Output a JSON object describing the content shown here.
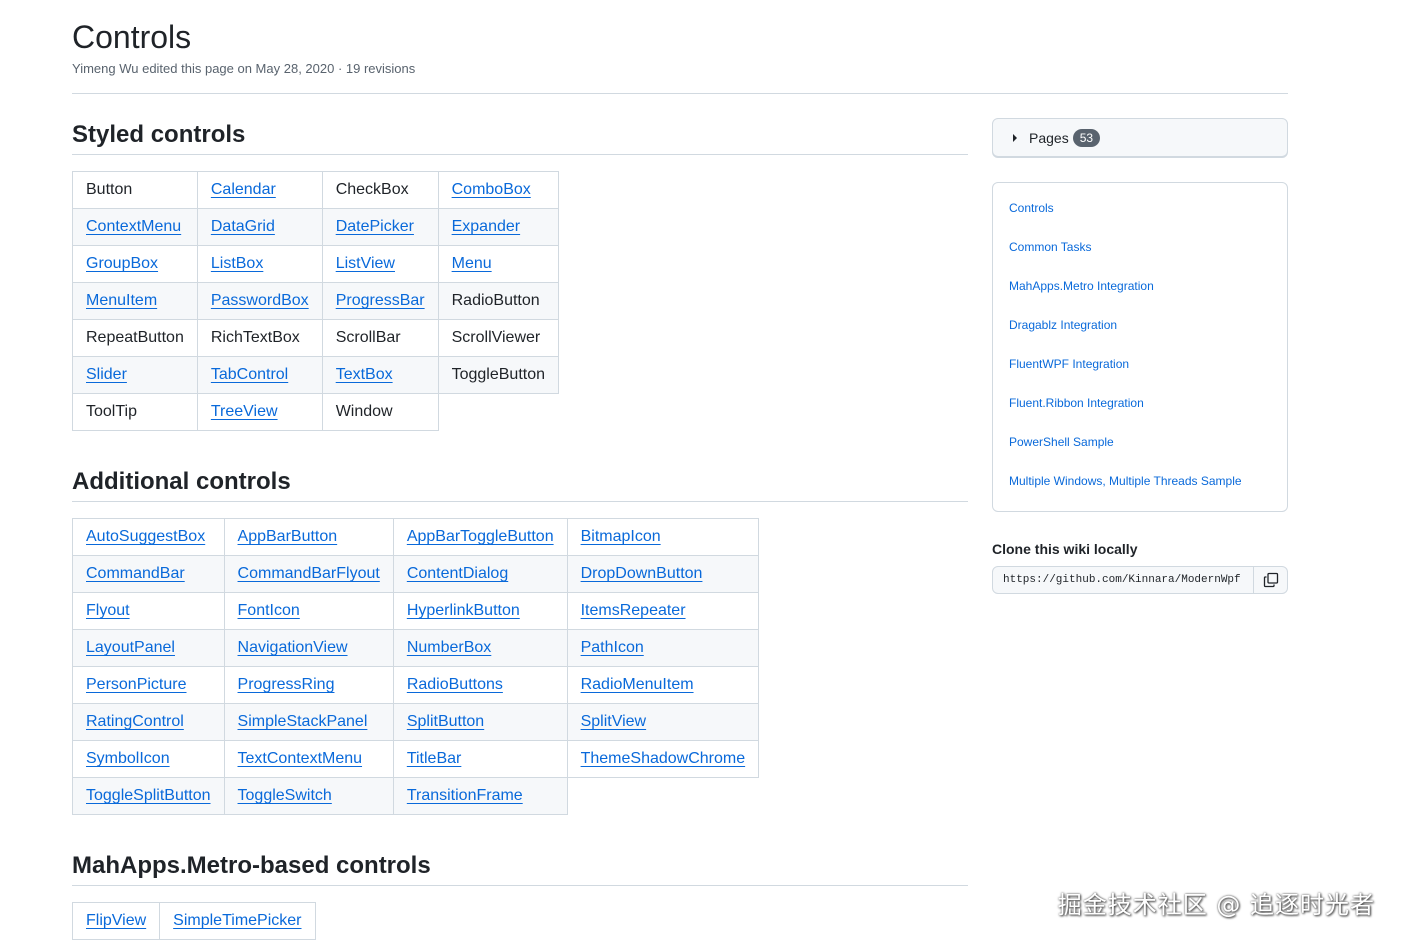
{
  "header": {
    "title": "Controls",
    "meta": "Yimeng Wu edited this page on May 28, 2020 · 19 revisions"
  },
  "sections": [
    {
      "title": "Styled controls",
      "rows": [
        [
          {
            "text": "Button",
            "link": false
          },
          {
            "text": "Calendar",
            "link": true
          },
          {
            "text": "CheckBox",
            "link": false
          },
          {
            "text": "ComboBox",
            "link": true
          }
        ],
        [
          {
            "text": "ContextMenu",
            "link": true
          },
          {
            "text": "DataGrid",
            "link": true
          },
          {
            "text": "DatePicker",
            "link": true
          },
          {
            "text": "Expander",
            "link": true
          }
        ],
        [
          {
            "text": "GroupBox",
            "link": true
          },
          {
            "text": "ListBox",
            "link": true
          },
          {
            "text": "ListView",
            "link": true
          },
          {
            "text": "Menu",
            "link": true
          }
        ],
        [
          {
            "text": "MenuItem",
            "link": true
          },
          {
            "text": "PasswordBox",
            "link": true
          },
          {
            "text": "ProgressBar",
            "link": true
          },
          {
            "text": "RadioButton",
            "link": false
          }
        ],
        [
          {
            "text": "RepeatButton",
            "link": false
          },
          {
            "text": "RichTextBox",
            "link": false
          },
          {
            "text": "ScrollBar",
            "link": false
          },
          {
            "text": "ScrollViewer",
            "link": false
          }
        ],
        [
          {
            "text": "Slider",
            "link": true
          },
          {
            "text": "TabControl",
            "link": true
          },
          {
            "text": "TextBox",
            "link": true
          },
          {
            "text": "ToggleButton",
            "link": false
          }
        ],
        [
          {
            "text": "ToolTip",
            "link": false
          },
          {
            "text": "TreeView",
            "link": true
          },
          {
            "text": "Window",
            "link": false
          }
        ]
      ]
    },
    {
      "title": "Additional controls",
      "rows": [
        [
          {
            "text": "AutoSuggestBox",
            "link": true
          },
          {
            "text": "AppBarButton",
            "link": true
          },
          {
            "text": "AppBarToggleButton",
            "link": true
          },
          {
            "text": "BitmapIcon",
            "link": true
          }
        ],
        [
          {
            "text": "CommandBar",
            "link": true
          },
          {
            "text": "CommandBarFlyout",
            "link": true
          },
          {
            "text": "ContentDialog",
            "link": true
          },
          {
            "text": "DropDownButton",
            "link": true
          }
        ],
        [
          {
            "text": "Flyout",
            "link": true
          },
          {
            "text": "FontIcon",
            "link": true
          },
          {
            "text": "HyperlinkButton",
            "link": true
          },
          {
            "text": "ItemsRepeater",
            "link": true
          }
        ],
        [
          {
            "text": "LayoutPanel",
            "link": true
          },
          {
            "text": "NavigationView",
            "link": true
          },
          {
            "text": "NumberBox",
            "link": true
          },
          {
            "text": "PathIcon",
            "link": true
          }
        ],
        [
          {
            "text": "PersonPicture",
            "link": true
          },
          {
            "text": "ProgressRing",
            "link": true
          },
          {
            "text": "RadioButtons",
            "link": true
          },
          {
            "text": "RadioMenuItem",
            "link": true
          }
        ],
        [
          {
            "text": "RatingControl",
            "link": true
          },
          {
            "text": "SimpleStackPanel",
            "link": true
          },
          {
            "text": "SplitButton",
            "link": true
          },
          {
            "text": "SplitView",
            "link": true
          }
        ],
        [
          {
            "text": "SymbolIcon",
            "link": true
          },
          {
            "text": "TextContextMenu",
            "link": true
          },
          {
            "text": "TitleBar",
            "link": true
          },
          {
            "text": "ThemeShadowChrome",
            "link": true
          }
        ],
        [
          {
            "text": "ToggleSplitButton",
            "link": true
          },
          {
            "text": "ToggleSwitch",
            "link": true
          },
          {
            "text": "TransitionFrame",
            "link": true
          }
        ]
      ]
    },
    {
      "title": "MahApps.Metro-based controls",
      "rows": [
        [
          {
            "text": "FlipView",
            "link": true
          },
          {
            "text": "SimpleTimePicker",
            "link": true
          }
        ]
      ]
    }
  ],
  "sidebar": {
    "pages_label": "Pages",
    "pages_count": "53",
    "links": [
      "Controls",
      "Common Tasks",
      "MahApps.Metro Integration",
      "Dragablz Integration",
      "FluentWPF Integration",
      "Fluent.Ribbon Integration",
      "PowerShell Sample",
      "Multiple Windows, Multiple Threads Sample"
    ],
    "clone_title": "Clone this wiki locally",
    "clone_url": "https://github.com/Kinnara/ModernWpf.wiki.git",
    "icons": {
      "toggle": "caret-right-icon",
      "copy": "copy-icon"
    }
  },
  "watermark": "掘金技术社区 @ 追逐时光者",
  "colors": {
    "link": "#0969da",
    "border": "#d1d9e0",
    "row_alt": "#f6f8fa",
    "counter_bg": "#59636e"
  }
}
